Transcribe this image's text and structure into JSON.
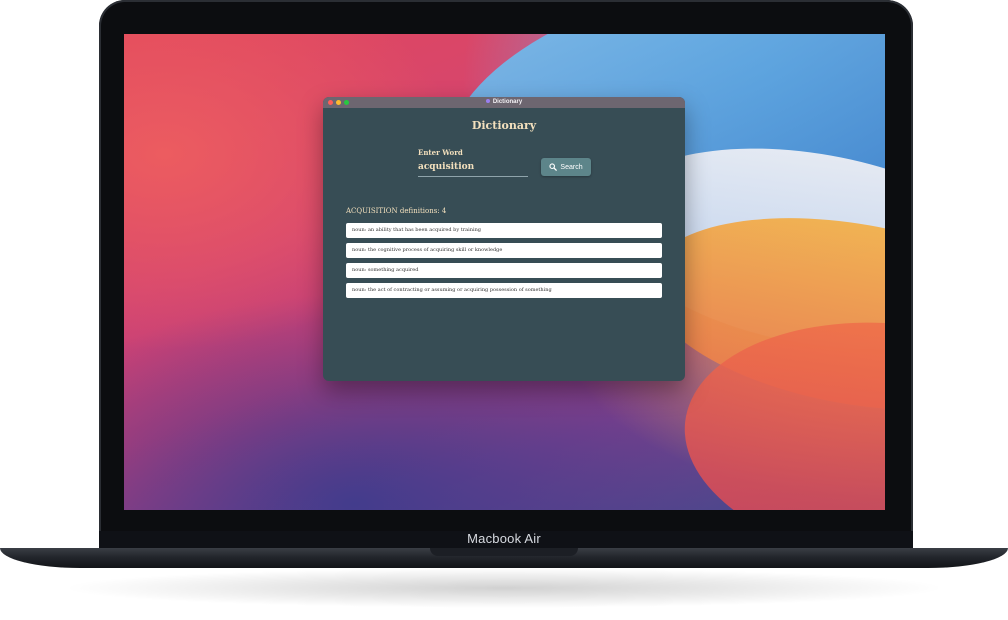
{
  "device": {
    "label": "Macbook Air"
  },
  "window": {
    "title": "Dictionary",
    "heading": "Dictionary",
    "input_label": "Enter Word",
    "input_value": "acquisition",
    "search_label": "Search",
    "results_title": "ACQUISITION definitions: 4",
    "definitions": [
      "noun: an ability that has been acquired by training",
      "noun: the cognitive process of acquiring skill or knowledge",
      "noun: something acquired",
      "noun: the act of contracting or assuming or acquiring possession of something"
    ]
  },
  "colors": {
    "window_bg": "#374d55",
    "titlebar": "#6d6670",
    "accent_text": "#f3e0bd",
    "button_bg": "#5d858a",
    "close": "#ff5f57",
    "minimize": "#febc2e",
    "maximize": "#28c840"
  },
  "icons": {
    "search": "magnifier-icon",
    "app": "app-icon"
  }
}
